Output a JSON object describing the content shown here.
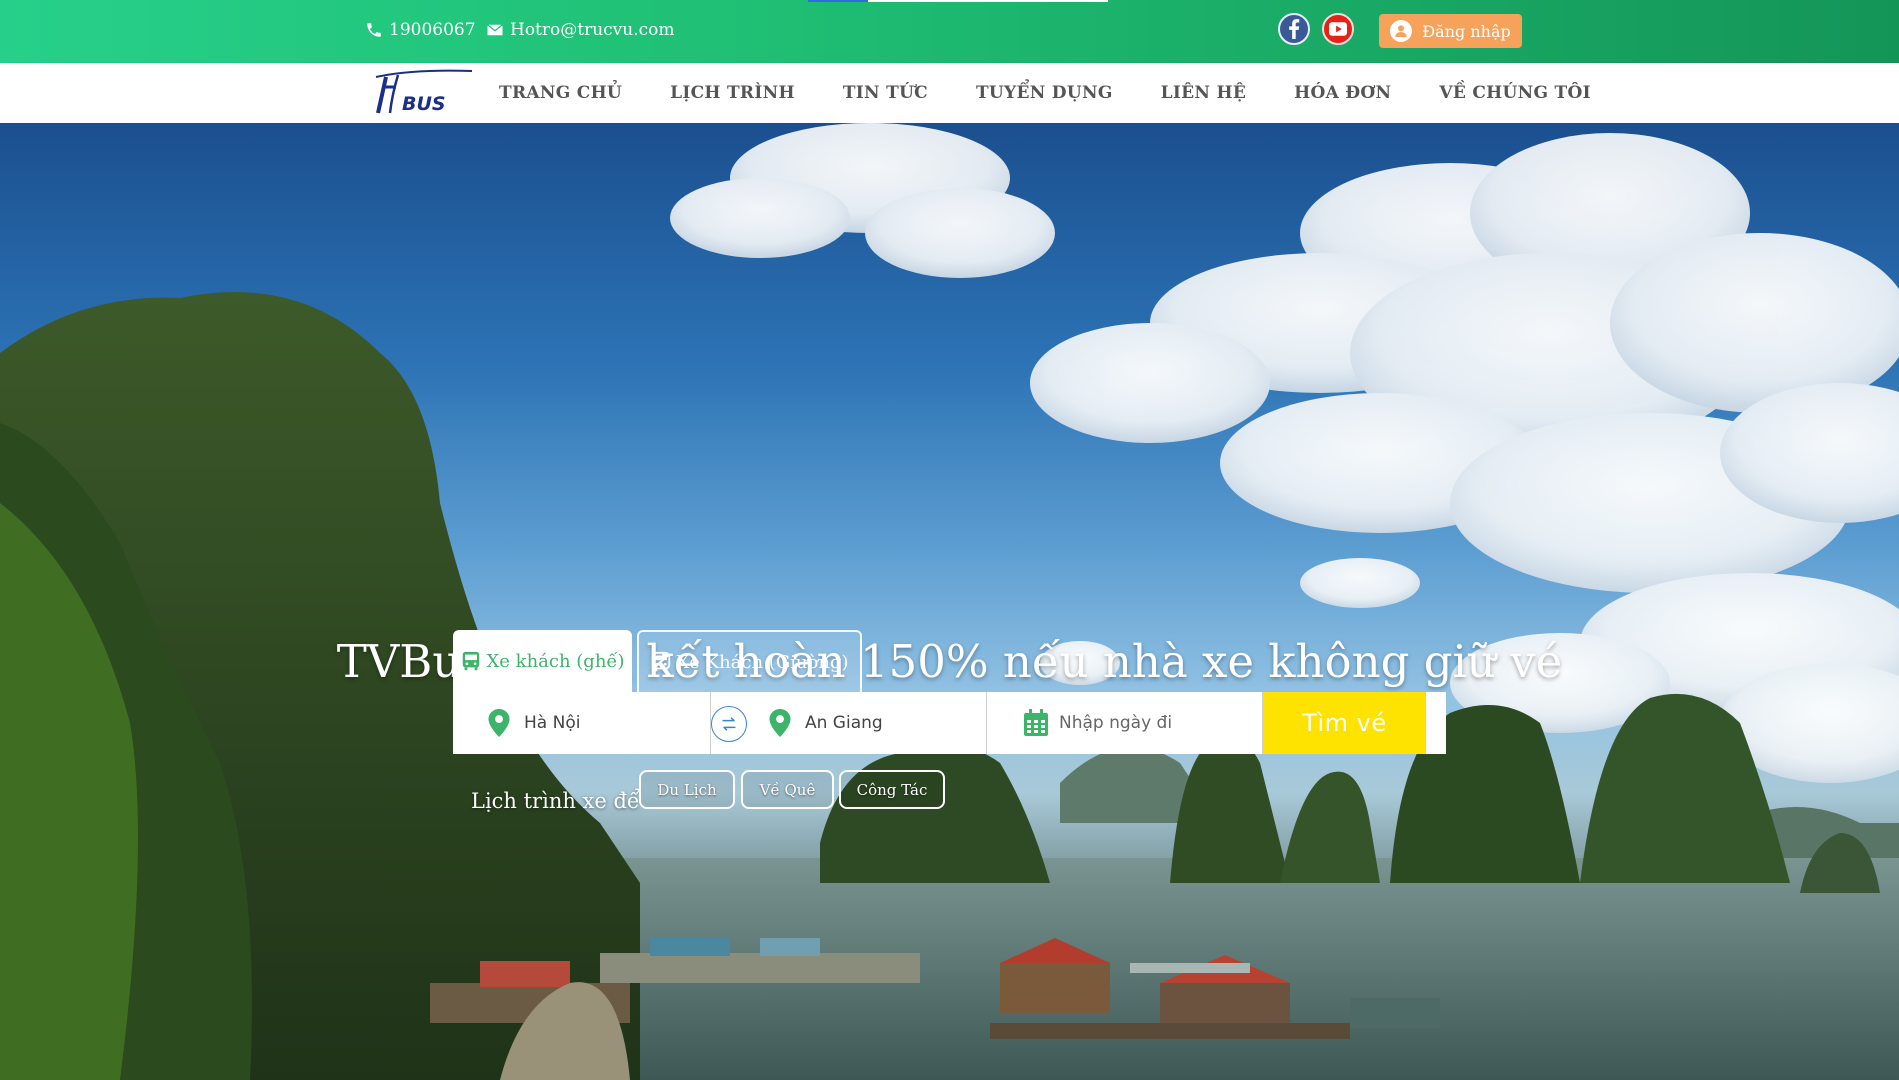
{
  "topbar": {
    "phone": "19006067",
    "email": "Hotro@trucvu.com",
    "login_label": "Đăng nhập",
    "social": [
      "facebook-icon",
      "youtube-icon"
    ]
  },
  "nav": {
    "logo_text": "BUS",
    "items": [
      "TRANG CHỦ",
      "LỊCH TRÌNH",
      "TIN TỨC",
      "TUYỂN DỤNG",
      "LIÊN HỆ",
      "HÓA ĐƠN",
      "VỀ CHÚNG TÔI"
    ]
  },
  "hero": {
    "headline": "TVBus - Cam kết hoàn 150% nếu nhà xe không giữ vé"
  },
  "search": {
    "tabs": [
      "Xe khách (ghế)",
      "Xe Khách (Giường)"
    ],
    "from": "Hà Nội",
    "to": "An Giang",
    "date_placeholder": "Nhập ngày đi",
    "button": "Tìm vé"
  },
  "purpose": {
    "label": "Lịch trình xe để",
    "chips": [
      "Du Lịch",
      "Về Quê",
      "Công Tác"
    ]
  },
  "colors": {
    "topbar_start": "#27d08a",
    "topbar_end": "#149558",
    "login_button": "#f7a25a",
    "search_button": "#ffe300",
    "active_tab_text": "#3cb56a",
    "pin": "#3cb56a"
  }
}
